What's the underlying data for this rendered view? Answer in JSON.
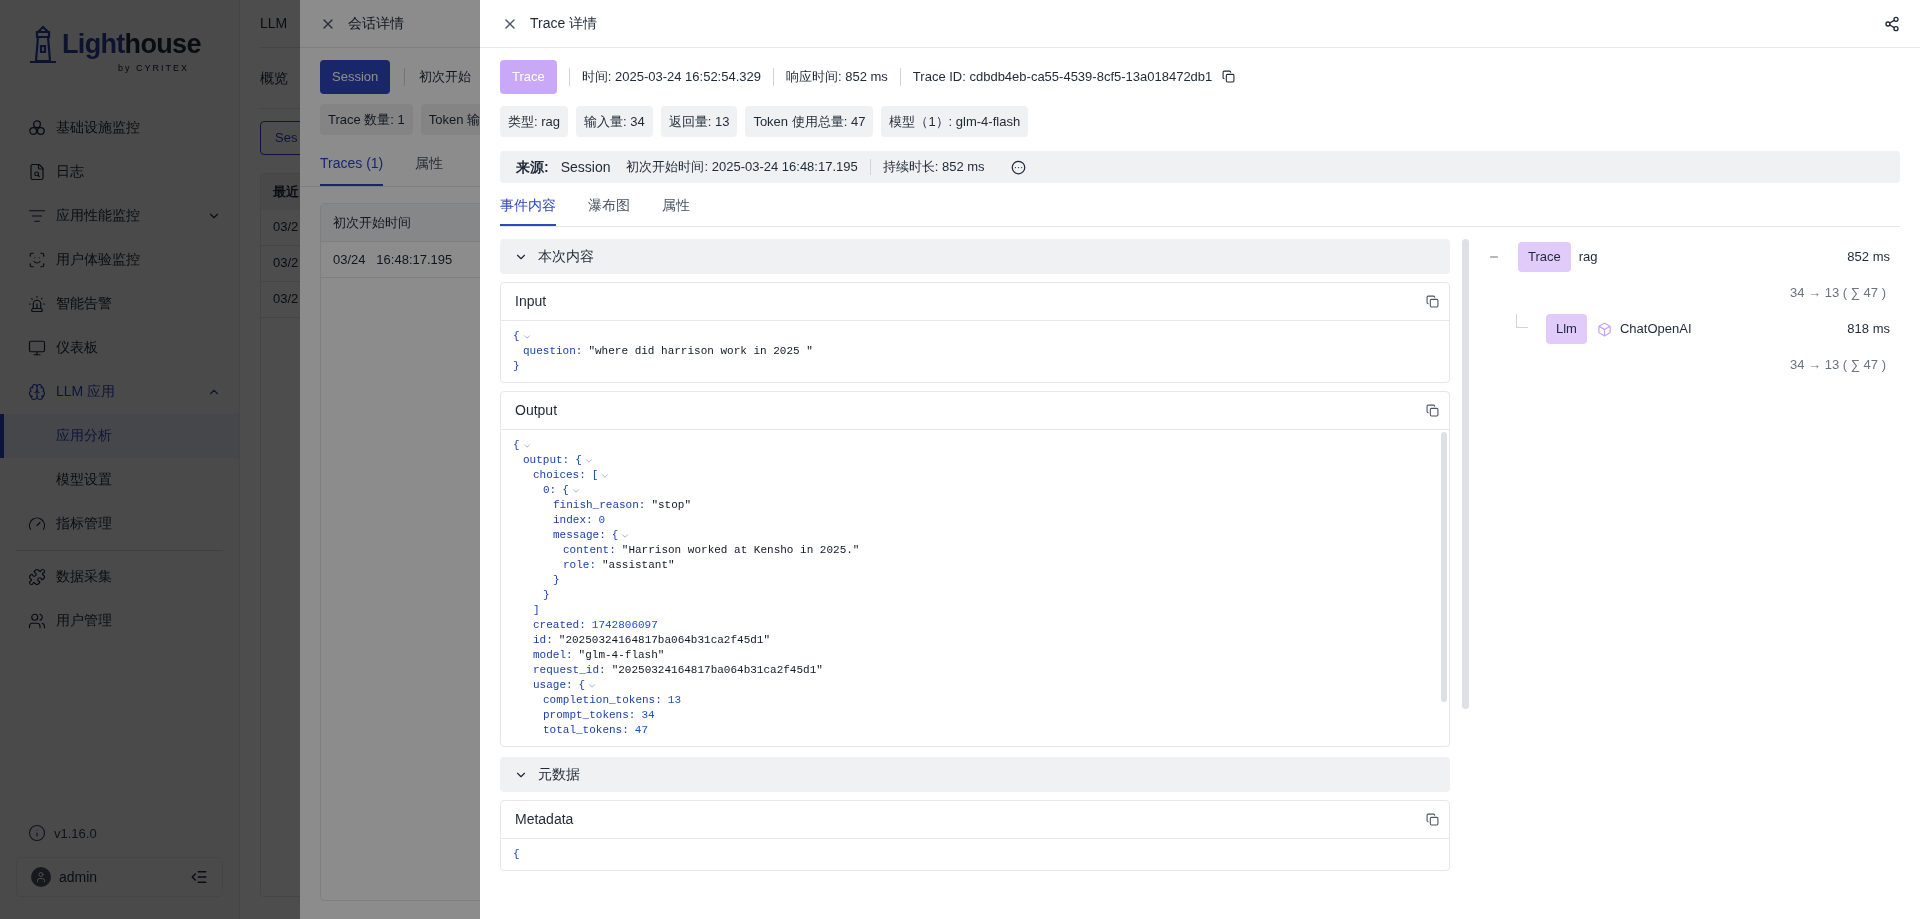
{
  "sidebar": {
    "logo": {
      "lead": "Light",
      "rest": "house",
      "tagline": "by CYRITEX"
    },
    "items": [
      {
        "kind": "link",
        "label": "基础设施监控"
      },
      {
        "kind": "link",
        "label": "日志"
      },
      {
        "kind": "group",
        "label": "应用性能监控",
        "active": false,
        "expanded": false
      },
      {
        "kind": "link",
        "label": "用户体验监控"
      },
      {
        "kind": "link",
        "label": "智能告警"
      },
      {
        "kind": "link",
        "label": "仪表板"
      },
      {
        "kind": "group",
        "label": "LLM 应用",
        "active": true,
        "expanded": true,
        "children": [
          {
            "label": "应用分析",
            "selected": true
          },
          {
            "label": "模型设置",
            "selected": false
          }
        ]
      },
      {
        "kind": "link",
        "label": "指标管理"
      },
      {
        "kind": "divider"
      },
      {
        "kind": "link",
        "label": "数据采集"
      },
      {
        "kind": "link",
        "label": "用户管理"
      }
    ],
    "version": "v1.16.0",
    "user": "admin"
  },
  "page": {
    "title": "LLM",
    "tab": "概览",
    "button": "Ses",
    "table_header": "最近",
    "rows": [
      "03/2",
      "03/2",
      "03/2"
    ]
  },
  "session_drawer": {
    "title": "会话详情",
    "badge": "Session",
    "start_label": "初次开始",
    "chips": [
      "Trace 数量: 1",
      "Token 输"
    ],
    "tabs": [
      {
        "label": "Traces (1)",
        "selected": true
      },
      {
        "label": "属性",
        "selected": false
      }
    ],
    "table": {
      "columns": [
        "初次开始时间"
      ],
      "rows": [
        [
          "03/24   16:48:17.195"
        ]
      ]
    }
  },
  "trace_drawer": {
    "title": "Trace 详情",
    "badge": "Trace",
    "meta": [
      "时间: 2025-03-24 16:52:54.329",
      "响应时间: 852 ms",
      "Trace ID: cdbdb4eb-ca55-4539-8cf5-13a018472db1"
    ],
    "chips": [
      "类型: rag",
      "输入量: 34",
      "返回量: 13",
      "Token 使用总量: 47",
      "模型（1）: glm-4-flash"
    ],
    "source": {
      "label": "来源:",
      "value": "Session",
      "items": [
        "初次开始时间: 2025-03-24 16:48:17.195",
        "持续时长: 852 ms"
      ]
    },
    "tabs": [
      {
        "label": "事件内容",
        "selected": true
      },
      {
        "label": "瀑布图",
        "selected": false
      },
      {
        "label": "属性",
        "selected": false
      }
    ],
    "sections": [
      {
        "title": "本次内容",
        "expanded": true,
        "cards": [
          {
            "title": "Input",
            "json": {
              "open": "{",
              "close": "}",
              "children": [
                {
                  "key": "question:",
                  "value": "\"where did harrison work in 2025 \"",
                  "kind": "string"
                }
              ]
            }
          },
          {
            "title": "Output",
            "json": {
              "open": "{",
              "children": [
                {
                  "key": "output:",
                  "open": "{",
                  "children": [
                    {
                      "key": "choices:",
                      "open": "[",
                      "close": "]",
                      "children": [
                        {
                          "key": "0:",
                          "open": "{",
                          "close": "}",
                          "children": [
                            {
                              "key": "finish_reason:",
                              "value": "\"stop\"",
                              "kind": "string"
                            },
                            {
                              "key": "index:",
                              "value": "0",
                              "kind": "number"
                            },
                            {
                              "key": "message:",
                              "open": "{",
                              "close": "}",
                              "children": [
                                {
                                  "key": "content:",
                                  "value": "\"Harrison worked at Kensho in 2025.\"",
                                  "kind": "string"
                                },
                                {
                                  "key": "role:",
                                  "value": "\"assistant\"",
                                  "kind": "string"
                                }
                              ]
                            }
                          ]
                        }
                      ]
                    },
                    {
                      "key": "created:",
                      "value": "1742806097",
                      "kind": "number"
                    },
                    {
                      "key": "id:",
                      "value": "\"20250324164817ba064b31ca2f45d1\"",
                      "kind": "string"
                    },
                    {
                      "key": "model:",
                      "value": "\"glm-4-flash\"",
                      "kind": "string"
                    },
                    {
                      "key": "request_id:",
                      "value": "\"20250324164817ba064b31ca2f45d1\"",
                      "kind": "string"
                    },
                    {
                      "key": "usage:",
                      "open": "{",
                      "children": [
                        {
                          "key": "completion_tokens:",
                          "value": "13",
                          "kind": "number"
                        },
                        {
                          "key": "prompt_tokens:",
                          "value": "34",
                          "kind": "number"
                        },
                        {
                          "key": "total_tokens:",
                          "value": "47",
                          "kind": "number"
                        }
                      ]
                    }
                  ]
                }
              ]
            }
          }
        ]
      },
      {
        "title": "元数据",
        "expanded": true,
        "cards": [
          {
            "title": "Metadata",
            "json": {
              "open": "{"
            }
          }
        ]
      }
    ],
    "tree": [
      {
        "type": "Trace",
        "name": "rag",
        "duration": "852 ms",
        "tokens": "34 → 13 ( ∑ 47 )",
        "expanded": true,
        "children": [
          {
            "type": "Llm",
            "name": "ChatOpenAI",
            "duration": "818 ms",
            "tokens": "34 → 13 ( ∑ 47 )"
          }
        ]
      }
    ]
  }
}
